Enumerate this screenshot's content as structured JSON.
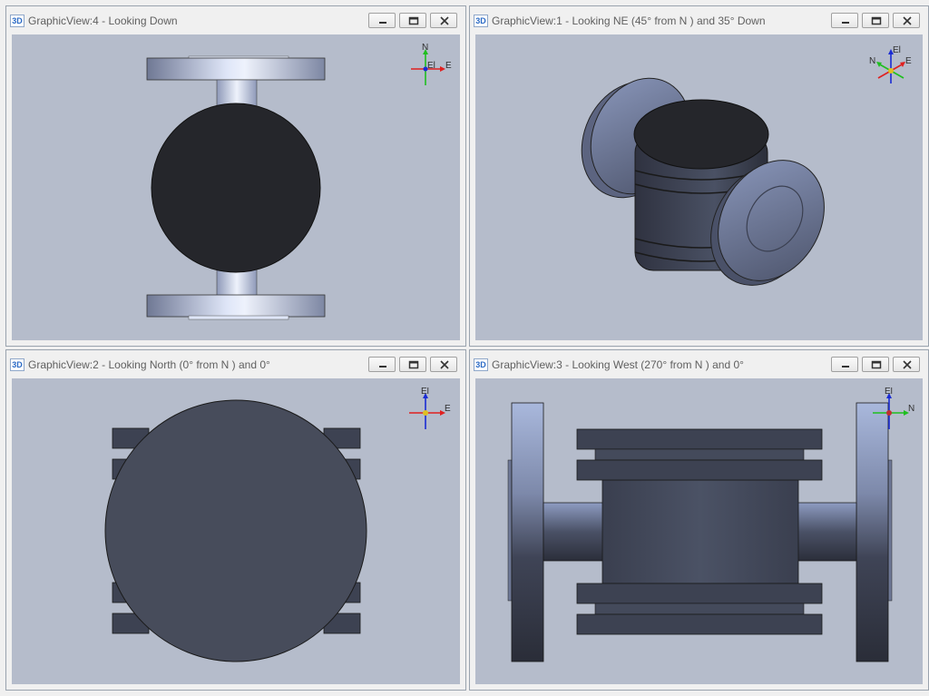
{
  "views": [
    {
      "id": "gv4",
      "title": "GraphicView:4 - Looking Down",
      "axis": {
        "labels": [
          "N",
          "E",
          "El"
        ]
      }
    },
    {
      "id": "gv1",
      "title": "GraphicView:1 - Looking NE (45° from N ) and 35° Down",
      "axis": {
        "labels": [
          "El",
          "N",
          "E"
        ]
      }
    },
    {
      "id": "gv2",
      "title": "GraphicView:2 - Looking North (0° from N ) and 0°",
      "axis": {
        "labels": [
          "El",
          "E"
        ]
      }
    },
    {
      "id": "gv3",
      "title": "GraphicView:3 - Looking West (270° from N ) and 0°",
      "axis": {
        "labels": [
          "El",
          "N"
        ]
      }
    }
  ],
  "app_icon": "3D",
  "icons": {
    "minimize": "minimize-icon",
    "restore": "restore-icon",
    "close": "close-icon"
  },
  "colors": {
    "viewport_bg": "#b5bccb",
    "model_dark": "#25262b",
    "model_mid": "#474c5b",
    "model_light": "#a9b8dc",
    "axis_n": "#1fbf1f",
    "axis_e": "#e02020",
    "axis_el": "#1a2bd4"
  }
}
